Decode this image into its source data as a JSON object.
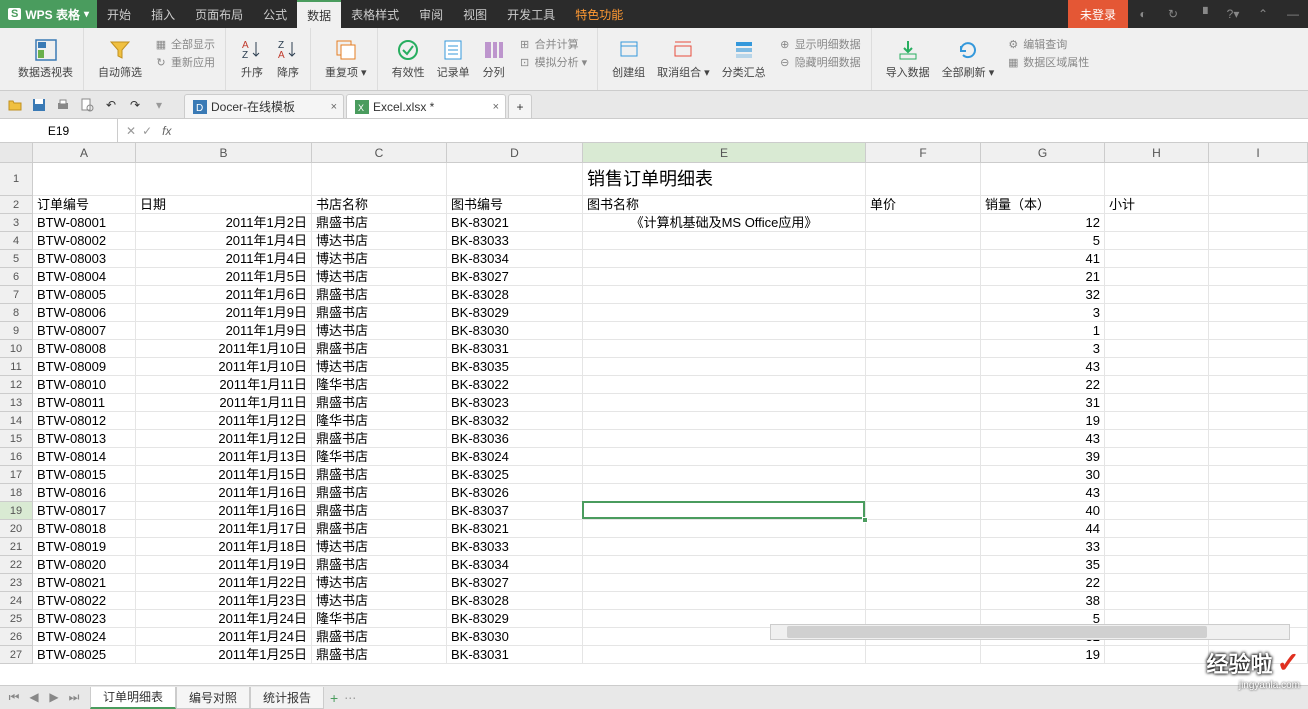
{
  "app": {
    "name": "WPS 表格",
    "login": "未登录"
  },
  "menus": [
    "开始",
    "插入",
    "页面布局",
    "公式",
    "数据",
    "表格样式",
    "审阅",
    "视图",
    "开发工具",
    "特色功能"
  ],
  "active_menu": 4,
  "special_menu": 9,
  "ribbon": {
    "pivot": "数据透视表",
    "autofilter": "自动筛选",
    "showall": "全部显示",
    "reapply": "重新应用",
    "sortasc": "升序",
    "sortdesc": "降序",
    "dedup": "重复项",
    "validation": "有效性",
    "form": "记录单",
    "texttocols": "分列",
    "consolidate": "合并计算",
    "whatif": "模拟分析",
    "group": "创建组",
    "ungroup": "取消组合",
    "subtotal": "分类汇总",
    "showdetail": "显示明细数据",
    "hidedetail": "隐藏明细数据",
    "import": "导入数据",
    "refreshall": "全部刷新",
    "editlinks": "编辑查询",
    "rangeprops": "数据区域属性"
  },
  "doc_tabs": [
    {
      "label": "Docer-在线模板"
    },
    {
      "label": "Excel.xlsx *"
    }
  ],
  "name_box": "E19",
  "colwidths": {
    "A": 103,
    "B": 176,
    "C": 135,
    "D": 136,
    "E": 283,
    "F": 115,
    "G": 124,
    "H": 104,
    "I": 99
  },
  "columns": [
    "A",
    "B",
    "C",
    "D",
    "E",
    "F",
    "G",
    "H",
    "I"
  ],
  "title_cell": "销售订单明细表",
  "headers": {
    "A": "订单编号",
    "B": "日期",
    "C": "书店名称",
    "D": "图书编号",
    "E": "图书名称",
    "F": "单价",
    "G": "销量（本）",
    "H": "小计"
  },
  "rows": [
    {
      "n": 3,
      "A": "BTW-08001",
      "B": "2011年1月2日",
      "C": "鼎盛书店",
      "D": "BK-83021",
      "E": "《计算机基础及MS Office应用》",
      "G": 12
    },
    {
      "n": 4,
      "A": "BTW-08002",
      "B": "2011年1月4日",
      "C": "博达书店",
      "D": "BK-83033",
      "G": 5
    },
    {
      "n": 5,
      "A": "BTW-08003",
      "B": "2011年1月4日",
      "C": "博达书店",
      "D": "BK-83034",
      "G": 41
    },
    {
      "n": 6,
      "A": "BTW-08004",
      "B": "2011年1月5日",
      "C": "博达书店",
      "D": "BK-83027",
      "G": 21
    },
    {
      "n": 7,
      "A": "BTW-08005",
      "B": "2011年1月6日",
      "C": "鼎盛书店",
      "D": "BK-83028",
      "G": 32
    },
    {
      "n": 8,
      "A": "BTW-08006",
      "B": "2011年1月9日",
      "C": "鼎盛书店",
      "D": "BK-83029",
      "G": 3
    },
    {
      "n": 9,
      "A": "BTW-08007",
      "B": "2011年1月9日",
      "C": "博达书店",
      "D": "BK-83030",
      "G": 1
    },
    {
      "n": 10,
      "A": "BTW-08008",
      "B": "2011年1月10日",
      "C": "鼎盛书店",
      "D": "BK-83031",
      "G": 3
    },
    {
      "n": 11,
      "A": "BTW-08009",
      "B": "2011年1月10日",
      "C": "博达书店",
      "D": "BK-83035",
      "G": 43
    },
    {
      "n": 12,
      "A": "BTW-08010",
      "B": "2011年1月11日",
      "C": "隆华书店",
      "D": "BK-83022",
      "G": 22
    },
    {
      "n": 13,
      "A": "BTW-08011",
      "B": "2011年1月11日",
      "C": "鼎盛书店",
      "D": "BK-83023",
      "G": 31
    },
    {
      "n": 14,
      "A": "BTW-08012",
      "B": "2011年1月12日",
      "C": "隆华书店",
      "D": "BK-83032",
      "G": 19
    },
    {
      "n": 15,
      "A": "BTW-08013",
      "B": "2011年1月12日",
      "C": "鼎盛书店",
      "D": "BK-83036",
      "G": 43
    },
    {
      "n": 16,
      "A": "BTW-08014",
      "B": "2011年1月13日",
      "C": "隆华书店",
      "D": "BK-83024",
      "G": 39
    },
    {
      "n": 17,
      "A": "BTW-08015",
      "B": "2011年1月15日",
      "C": "鼎盛书店",
      "D": "BK-83025",
      "G": 30
    },
    {
      "n": 18,
      "A": "BTW-08016",
      "B": "2011年1月16日",
      "C": "鼎盛书店",
      "D": "BK-83026",
      "G": 43
    },
    {
      "n": 19,
      "A": "BTW-08017",
      "B": "2011年1月16日",
      "C": "鼎盛书店",
      "D": "BK-83037",
      "G": 40
    },
    {
      "n": 20,
      "A": "BTW-08018",
      "B": "2011年1月17日",
      "C": "鼎盛书店",
      "D": "BK-83021",
      "G": 44
    },
    {
      "n": 21,
      "A": "BTW-08019",
      "B": "2011年1月18日",
      "C": "博达书店",
      "D": "BK-83033",
      "G": 33
    },
    {
      "n": 22,
      "A": "BTW-08020",
      "B": "2011年1月19日",
      "C": "鼎盛书店",
      "D": "BK-83034",
      "G": 35
    },
    {
      "n": 23,
      "A": "BTW-08021",
      "B": "2011年1月22日",
      "C": "博达书店",
      "D": "BK-83027",
      "G": 22
    },
    {
      "n": 24,
      "A": "BTW-08022",
      "B": "2011年1月23日",
      "C": "博达书店",
      "D": "BK-83028",
      "G": 38
    },
    {
      "n": 25,
      "A": "BTW-08023",
      "B": "2011年1月24日",
      "C": "隆华书店",
      "D": "BK-83029",
      "G": 5
    },
    {
      "n": 26,
      "A": "BTW-08024",
      "B": "2011年1月24日",
      "C": "鼎盛书店",
      "D": "BK-83030",
      "G": 32
    },
    {
      "n": 27,
      "A": "BTW-08025",
      "B": "2011年1月25日",
      "C": "鼎盛书店",
      "D": "BK-83031",
      "G": 19
    }
  ],
  "sheet_tabs": [
    "订单明细表",
    "编号对照",
    "统计报告"
  ],
  "active_sheet": 0,
  "selection": {
    "cell": "E19"
  },
  "watermark": {
    "text": "经验啦",
    "url": "jingyanla.com"
  }
}
